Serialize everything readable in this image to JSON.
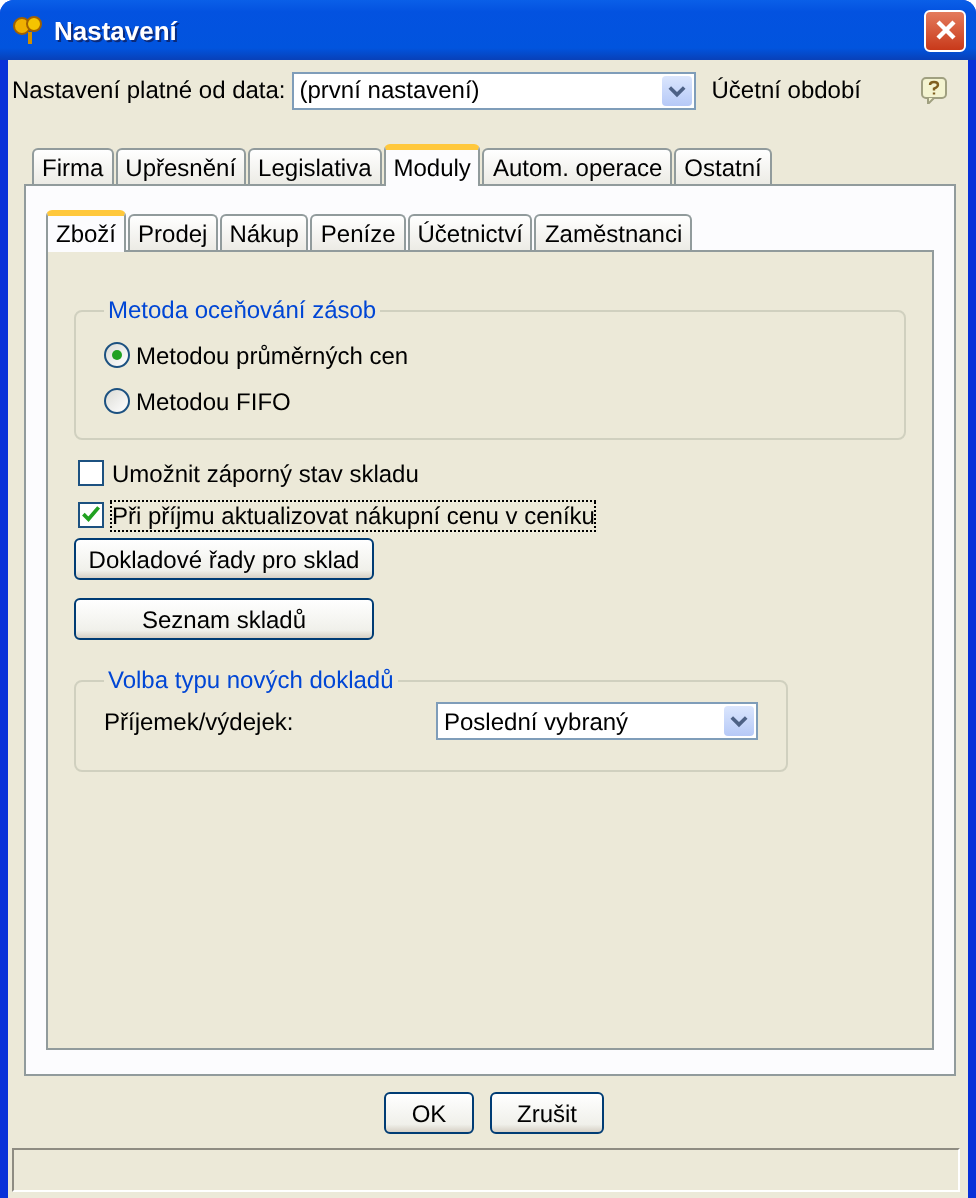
{
  "window": {
    "title": "Nastavení"
  },
  "header": {
    "label": "Nastavení platné od data:",
    "combo": {
      "value": "(první nastavení)"
    },
    "period_label": "Účetní období"
  },
  "tabs": [
    {
      "label": "Firma",
      "selected": false
    },
    {
      "label": "Upřesnění",
      "selected": false
    },
    {
      "label": "Legislativa",
      "selected": false
    },
    {
      "label": "Moduly",
      "selected": true
    },
    {
      "label": "Autom. operace",
      "selected": false
    },
    {
      "label": "Ostatní",
      "selected": false
    }
  ],
  "subtabs": [
    {
      "label": "Zboží",
      "selected": true
    },
    {
      "label": "Prodej",
      "selected": false
    },
    {
      "label": "Nákup",
      "selected": false
    },
    {
      "label": "Peníze",
      "selected": false
    },
    {
      "label": "Účetnictví",
      "selected": false
    },
    {
      "label": "Zaměstnanci",
      "selected": false
    }
  ],
  "valuation_group": {
    "title": "Metoda oceňování zásob",
    "options": [
      {
        "label": "Metodou průměrných cen",
        "selected": true
      },
      {
        "label": "Metodou FIFO",
        "selected": false
      }
    ]
  },
  "checkboxes": [
    {
      "label": "Umožnit záporný stav skladu",
      "checked": false,
      "focused": false
    },
    {
      "label": "Při příjmu aktualizovat nákupní cenu v ceníku",
      "checked": true,
      "focused": true
    }
  ],
  "buttons": [
    "Dokladové řady pro sklad",
    "Seznam skladů"
  ],
  "document_group": {
    "title": "Volba typu nových dokladů",
    "label": "Příjemek/výdejek:",
    "combo": {
      "value": "Poslední vybraný"
    }
  },
  "dialog_buttons": [
    "OK",
    "Zrušit"
  ]
}
